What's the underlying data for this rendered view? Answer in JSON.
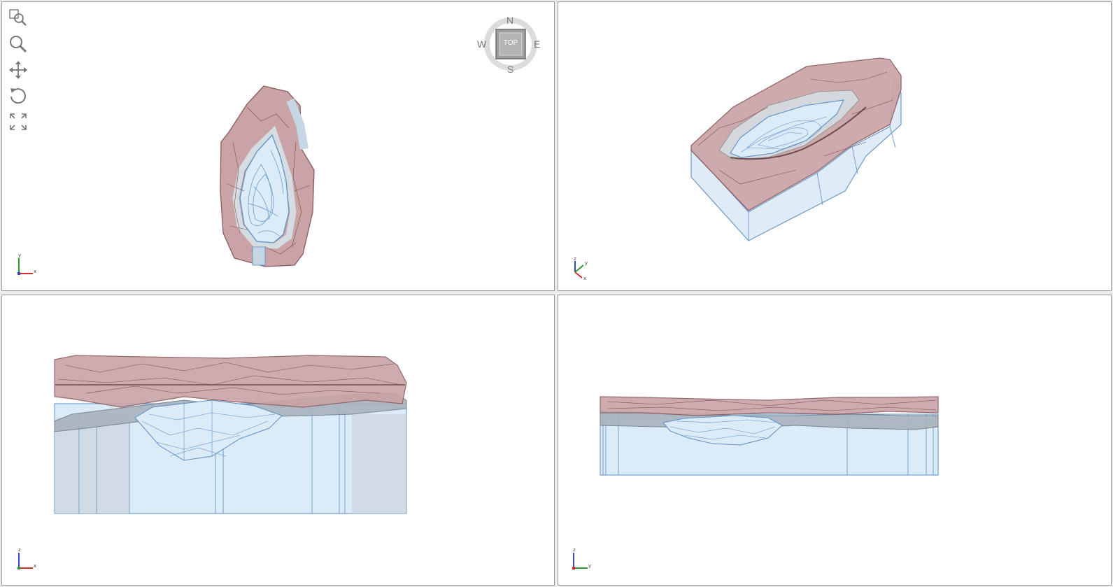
{
  "toolbar": {
    "tools": [
      {
        "name": "zoom-window",
        "icon": "zoom-window-icon"
      },
      {
        "name": "zoom",
        "icon": "magnifier-icon"
      },
      {
        "name": "pan",
        "icon": "pan-arrows-icon"
      },
      {
        "name": "rotate",
        "icon": "rotate-icon"
      },
      {
        "name": "zoom-extents",
        "icon": "expand-corners-icon"
      }
    ]
  },
  "navcube": {
    "north": "N",
    "south": "S",
    "east": "E",
    "west": "W",
    "face": "TOP"
  },
  "axes": {
    "top_view": {
      "vertical": "y",
      "horizontal": "x"
    },
    "iso_view": {
      "vertical": "z",
      "diag_up": "y",
      "diag_down": "x"
    },
    "front_view": {
      "vertical": "z",
      "horizontal": "x"
    },
    "side_view": {
      "vertical": "z",
      "horizontal": "y"
    }
  },
  "colors": {
    "terrain_fill": "#c9a3a6",
    "terrain_stroke": "#8a5a5e",
    "water_fill": "#dcebf8",
    "water_stroke": "#5b8fc7",
    "gray_layer": "#a9b3bd",
    "axis_x": "#d42a2a",
    "axis_y": "#2f9a2f",
    "axis_z": "#2a4fd4"
  }
}
